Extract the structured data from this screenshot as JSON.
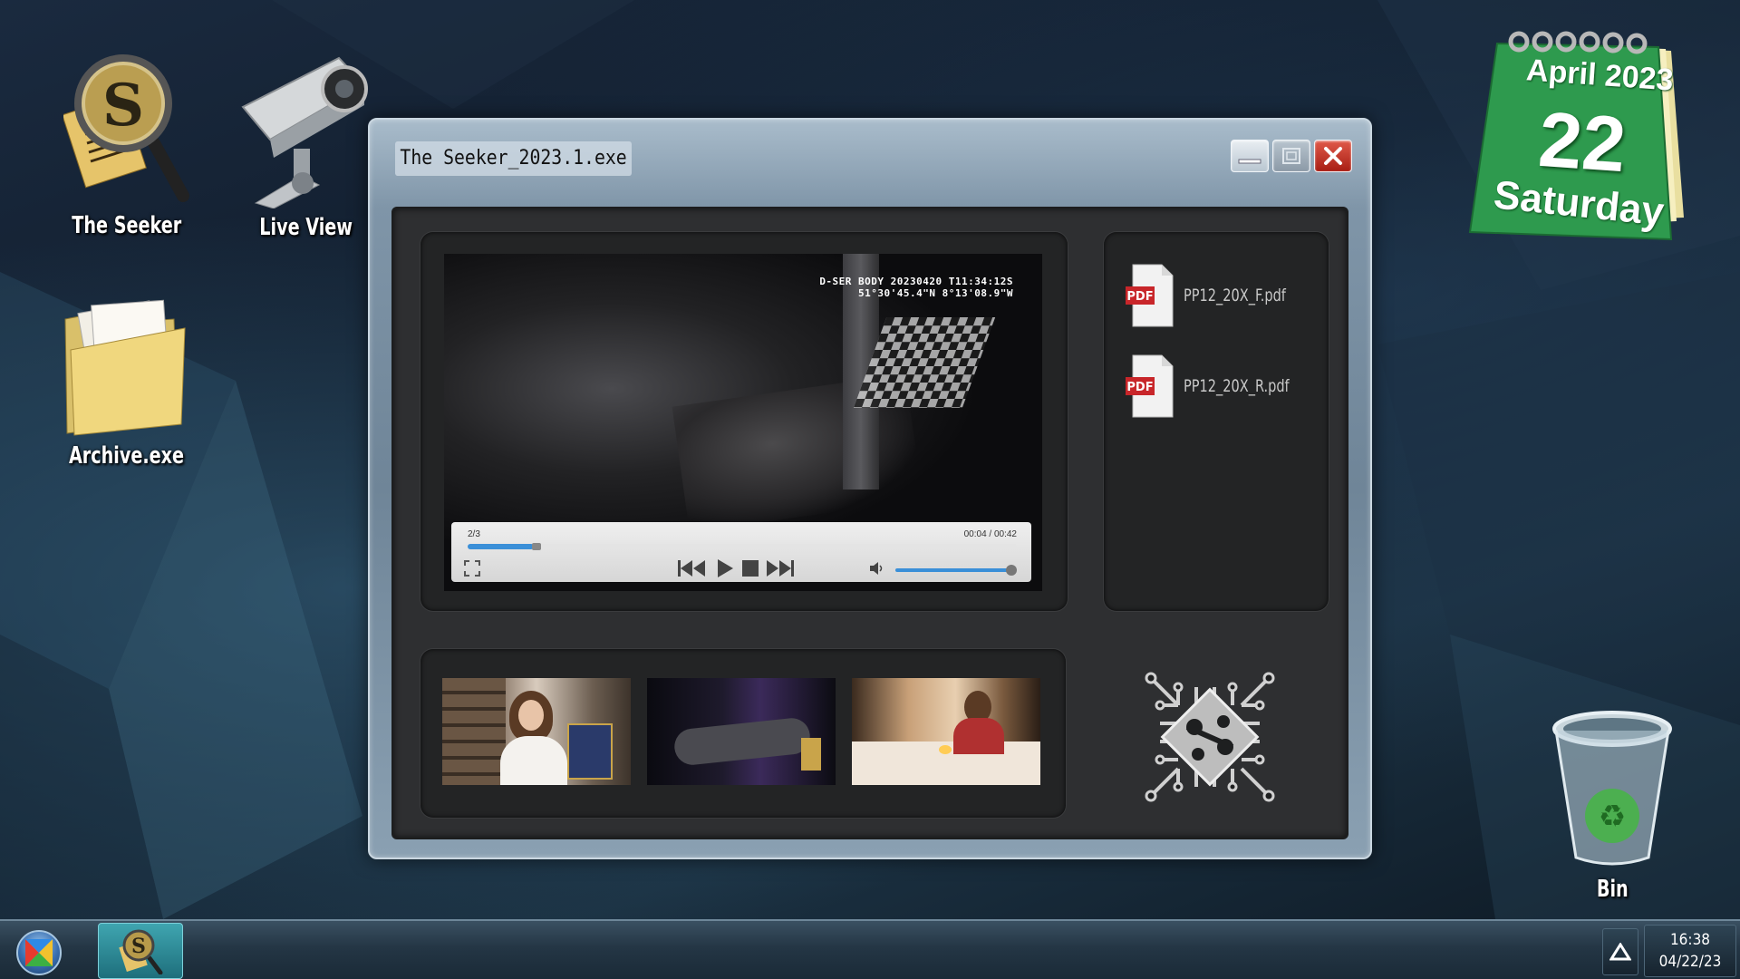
{
  "desktop": {
    "icons": [
      {
        "label": "The Seeker"
      },
      {
        "label": "Live View"
      },
      {
        "label": "Archive.exe"
      },
      {
        "label": "Bin"
      }
    ]
  },
  "calendar": {
    "month": "April",
    "year": "2023",
    "day": "22",
    "weekday": "Saturday",
    "color": "#2e9a4e"
  },
  "window": {
    "title": "The Seeker_2023.1.exe",
    "video": {
      "overlay_line1": "D-SER BODY 20230420 T11:34:12S",
      "overlay_line2": "51°30'45.4\"N 8°13'08.9\"W",
      "clip_counter": "2/3",
      "time": "00:04 / 00:42",
      "progress": 0.12,
      "volume": 1.0,
      "accent": "#3a8fd8"
    },
    "files": [
      {
        "name": "PP12_20X_F.pdf",
        "icon": "pdf-icon"
      },
      {
        "name": "PP12_20X_R.pdf",
        "icon": "pdf-icon"
      }
    ],
    "thumbnails": [
      {
        "name": "thumbnail-1"
      },
      {
        "name": "thumbnail-2"
      },
      {
        "name": "thumbnail-3"
      }
    ]
  },
  "taskbar": {
    "time": "16:38",
    "date": "04/22/23"
  }
}
